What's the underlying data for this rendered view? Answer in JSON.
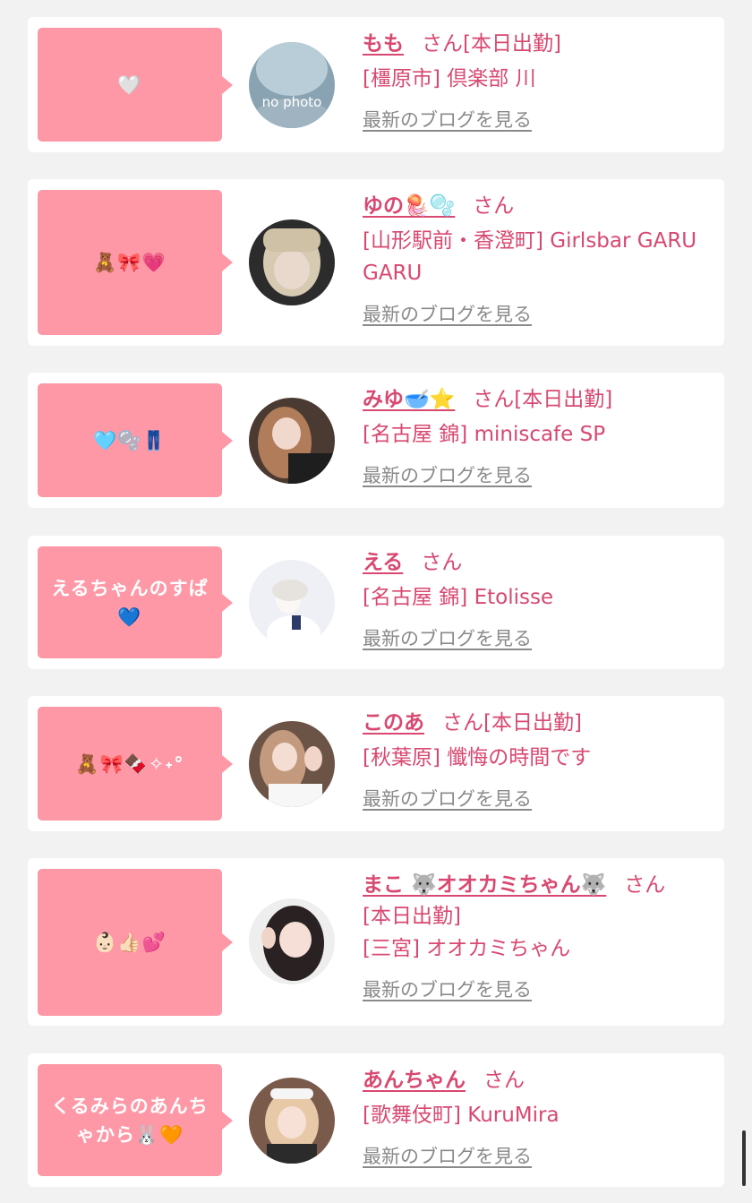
{
  "colors": {
    "bubble": "#fe98a6",
    "name": "#d84870",
    "blog_link": "#8a8a8a",
    "card": "#ffffff",
    "background": "#f2f2f2"
  },
  "blog_link_label": "最新のブログを見る",
  "honorific": "さん",
  "cards": [
    {
      "message": "🤍",
      "name": "もも",
      "status": "[本日出勤]",
      "venue": "[橿原市] 倶楽部 川",
      "avatar": "no-photo",
      "avatar_text": "no photo"
    },
    {
      "message": "🧸🎀💗",
      "name": "ゆの🪼🫧",
      "status": "",
      "venue": "[山形駅前・香澄町] Girlsbar GARU GARU",
      "avatar": "photo"
    },
    {
      "message": "🩵🫧👖",
      "name": "みゆ🥣⭐",
      "status": "[本日出勤]",
      "venue": "[名古屋 錦] miniscafe SP",
      "avatar": "photo"
    },
    {
      "message": "えるちゃんのすぱ💙",
      "name": "える",
      "status": "",
      "venue": "[名古屋 錦] Etolisse",
      "avatar": "photo"
    },
    {
      "message": "🧸🎀🍫✧˖°",
      "name": "このあ",
      "status": "[本日出勤]",
      "venue": "[秋葉原] 懺悔の時間です",
      "avatar": "photo"
    },
    {
      "message": "👶🏻👍🏻💕",
      "name": "まこ 🐺オオカミちゃん🐺",
      "status": "[本日出勤]",
      "venue": "[三宮] オオカミちゃん",
      "avatar": "photo"
    },
    {
      "message": "くるみらのあんちゃから🐰🧡",
      "name": "あんちゃん",
      "status": "",
      "venue": "[歌舞伎町] KuruMira",
      "avatar": "photo"
    }
  ]
}
